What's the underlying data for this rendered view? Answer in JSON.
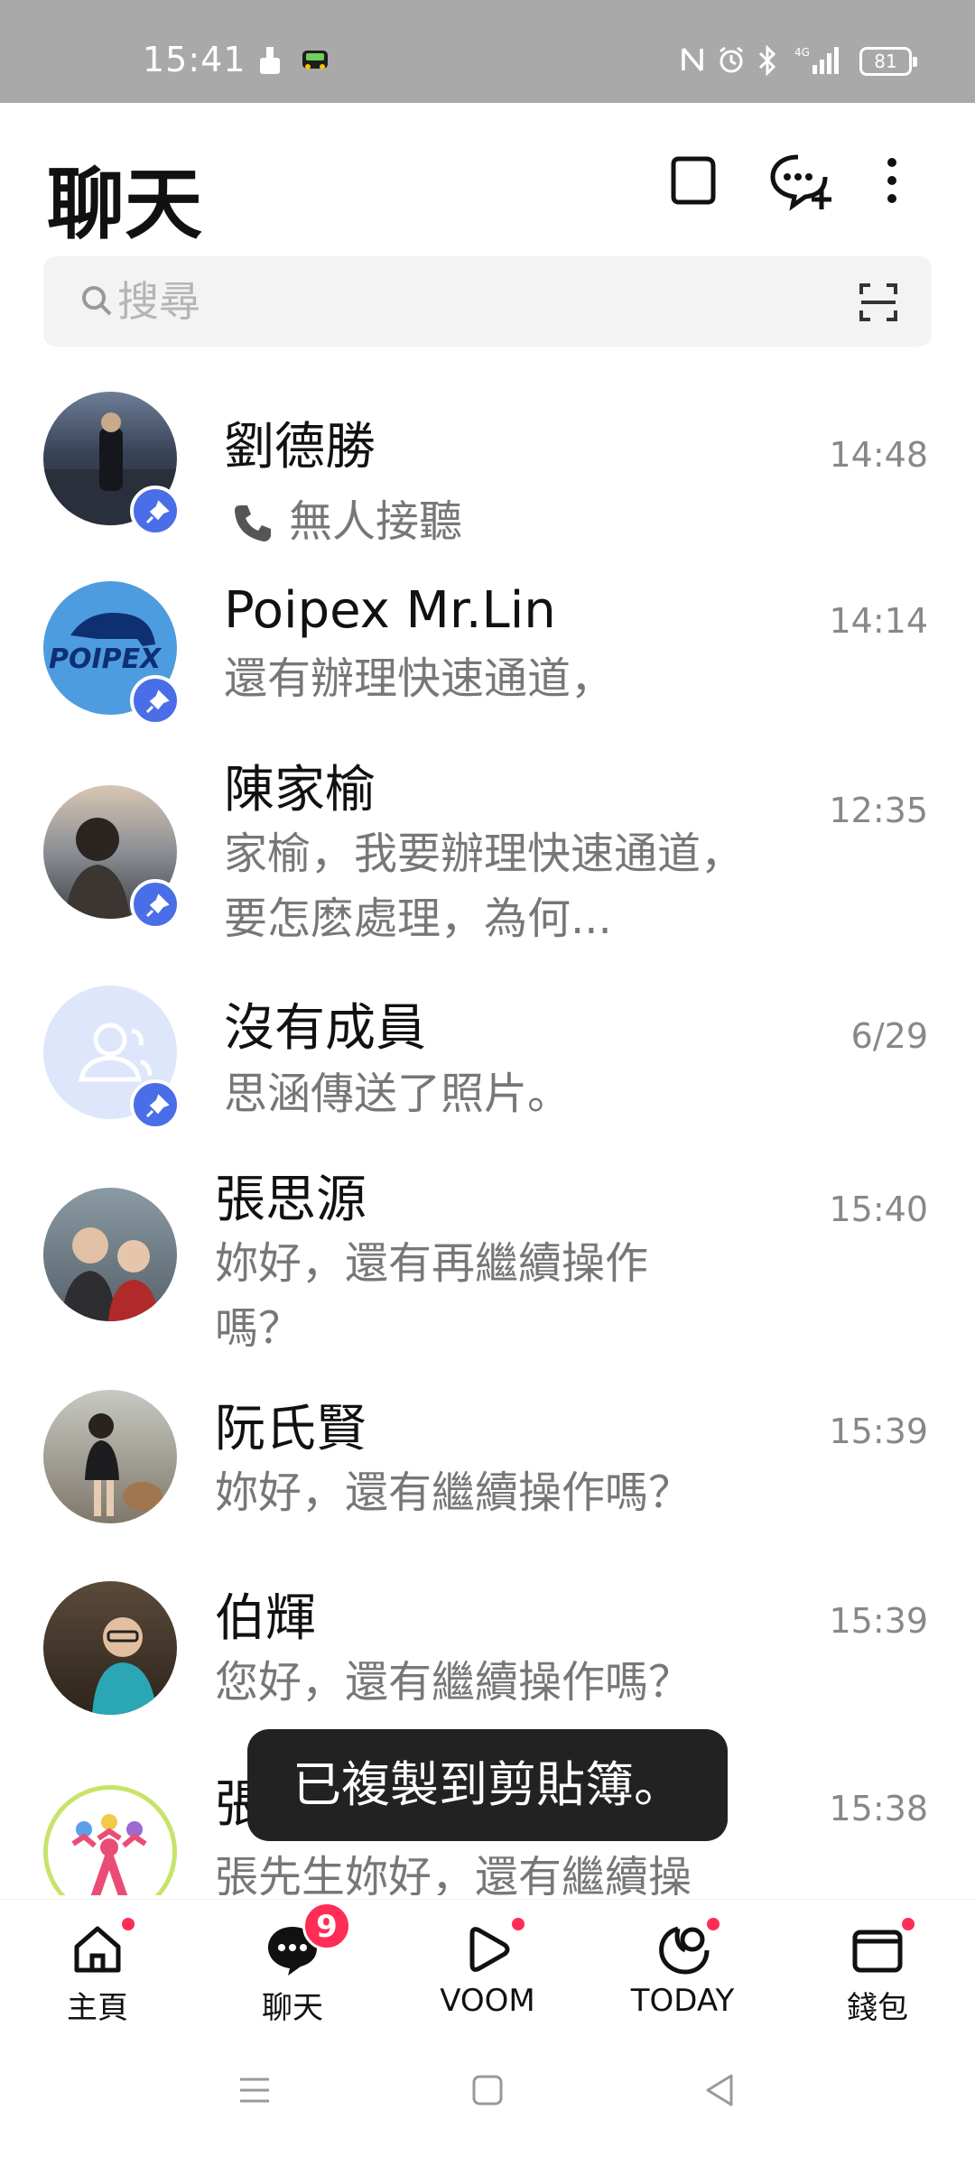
{
  "status_bar": {
    "time": "15:41",
    "battery": "81",
    "network": "4G"
  },
  "header": {
    "title": "聊天"
  },
  "search": {
    "placeholder": "搜尋"
  },
  "chats": [
    {
      "name": "劉德勝",
      "message": "無人接聽",
      "time": "14:48",
      "pinned": true,
      "call": true
    },
    {
      "name": "Poipex  Mr.Lin",
      "message": "還有辦理快速通道，",
      "time": "14:14",
      "pinned": true,
      "avatar_text": "POIPEX"
    },
    {
      "name": "陳家榆",
      "message": "家榆，我要辦理快速通道，要怎麽處理，為何...",
      "time": "12:35",
      "pinned": true
    },
    {
      "name": "沒有成員",
      "message": "思涵傳送了照片。",
      "time": "6/29",
      "pinned": true
    },
    {
      "name": "張思源",
      "message": "妳好，還有再繼續操作嗎？",
      "time": "15:40",
      "pinned": false
    },
    {
      "name": "阮氏賢",
      "message": "妳好，還有繼續操作嗎？",
      "time": "15:39",
      "pinned": false
    },
    {
      "name": "伯輝",
      "message": "您好，還有繼續操作嗎？",
      "time": "15:39",
      "pinned": false
    },
    {
      "name": "張",
      "message": "張先生妳好，還有繼續操",
      "time": "15:38",
      "pinned": false
    }
  ],
  "toast": "已複製到剪貼簿。",
  "bottom_nav": [
    {
      "label": "主頁",
      "dot": true
    },
    {
      "label": "聊天",
      "badge": "9"
    },
    {
      "label": "VOOM",
      "dot": true
    },
    {
      "label": "TODAY",
      "dot": true
    },
    {
      "label": "錢包",
      "dot": true
    }
  ],
  "colors": {
    "accent": "#4a6ee8",
    "badge": "#ff2d55",
    "status_bar": "#a9a9a9",
    "toast": "#222222"
  }
}
